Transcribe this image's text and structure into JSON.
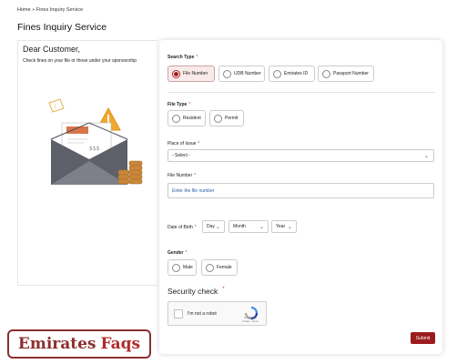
{
  "breadcrumb": {
    "home": "Home",
    "separator": "»",
    "current": "Fines Inquiry Service"
  },
  "page": {
    "title": "Fines Inquiry Service"
  },
  "intro": {
    "greeting": "Dear Customer,",
    "subtext": "Check fines on your file or those under your sponsorship",
    "illustration": "envelope-with-warning-and-coins"
  },
  "form": {
    "search_type": {
      "label": "Search Type",
      "required_mark": "*",
      "options": [
        "File Number",
        "UDB Number",
        "Emirates ID",
        "Passport Number"
      ],
      "selected": "File Number"
    },
    "file_type": {
      "label": "File Type",
      "required_mark": "*",
      "options": [
        "Resident",
        "Permit"
      ],
      "selected": null
    },
    "place_of_issue": {
      "label": "Place of Issue",
      "required_mark": "*",
      "value": "- Select -"
    },
    "file_number": {
      "label": "File Number",
      "required_mark": "*",
      "placeholder": "Enter the file number"
    },
    "date_of_birth": {
      "label": "Date of Birth",
      "required_mark": "*",
      "day": "Day",
      "month": "Month",
      "year": "Year"
    },
    "gender": {
      "label": "Gender",
      "required_mark": "*",
      "options": [
        "Male",
        "Female"
      ],
      "selected": null
    },
    "security": {
      "title": "Security check",
      "required_mark": "*",
      "captcha_label": "I'm not a robot",
      "captcha_brand": "reCAPTCHA",
      "captcha_links": "Privacy - Terms"
    },
    "submit_label": "Submit"
  },
  "watermark": {
    "word1": "Emirates",
    "word2": "Faqs"
  },
  "colors": {
    "accent": "#9b1c1c",
    "watermark": "#8b2f2f",
    "required": "#c0392b",
    "link_text": "#2a5da8"
  }
}
